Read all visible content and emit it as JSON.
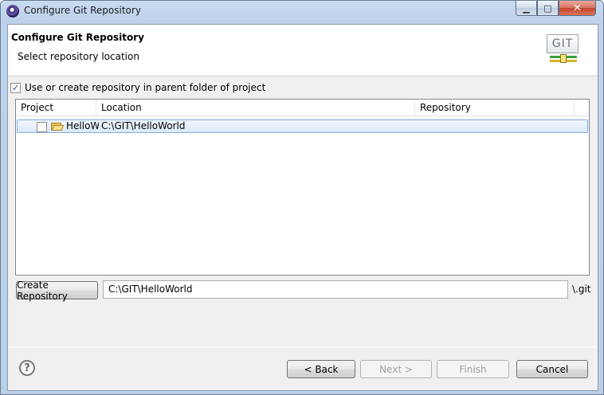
{
  "window": {
    "title": "Configure Git Repository",
    "close_glyph": "✕",
    "minimize_glyph": "▁",
    "maximize_glyph": "□"
  },
  "banner": {
    "title": "Configure Git Repository",
    "description": "Select repository location",
    "logo_text": "GIT"
  },
  "options": {
    "use_parent_label": "Use or create repository in parent folder of project",
    "use_parent_checked": true,
    "check_glyph": "✓"
  },
  "table": {
    "columns": [
      "Project",
      "Location",
      "Repository"
    ],
    "rows": [
      {
        "project": "HelloWorld",
        "location": "C:\\GIT\\HelloWorld",
        "repository": "",
        "checked": false,
        "selected": true
      }
    ]
  },
  "create": {
    "button_label": "Create Repository",
    "path_value": "C:\\GIT\\HelloWorld",
    "suffix": "\\.git"
  },
  "footer": {
    "help_glyph": "?",
    "back_label": "< Back",
    "next_label": "Next >",
    "finish_label": "Finish",
    "cancel_label": "Cancel"
  }
}
